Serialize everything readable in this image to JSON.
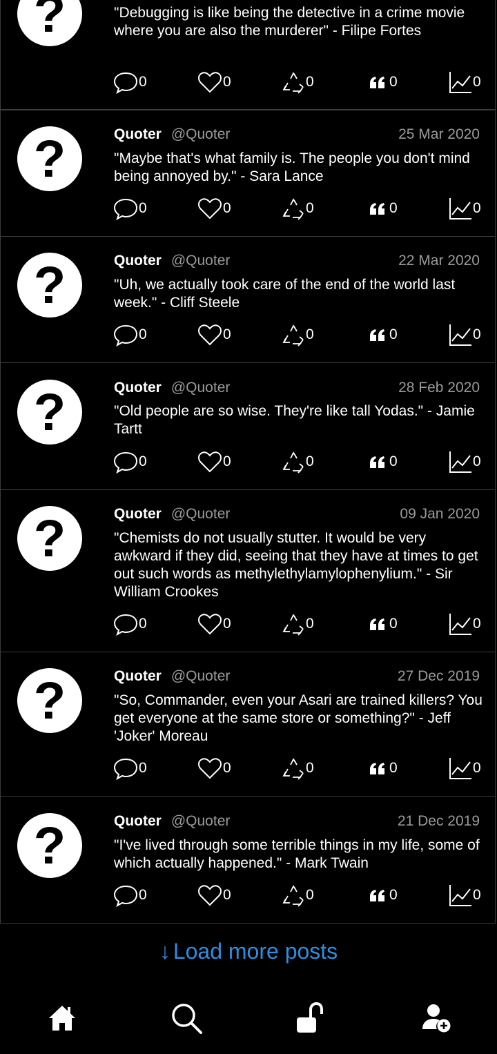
{
  "posts": [
    {
      "author": "",
      "handle": "",
      "date": "",
      "text": "\"Debugging is like being the detective in a crime movie where you are also the murderer\" - Filipe Fortes",
      "counts": {
        "comments": "0",
        "likes": "0",
        "reposts": "0",
        "quotes": "0",
        "stats": "0"
      }
    },
    {
      "author": "Quoter",
      "handle": "@Quoter",
      "date": "25 Mar 2020",
      "text": "\"Maybe that's what family is. The people you don't mind being annoyed by.\" - Sara Lance",
      "counts": {
        "comments": "0",
        "likes": "0",
        "reposts": "0",
        "quotes": "0",
        "stats": "0"
      }
    },
    {
      "author": "Quoter",
      "handle": "@Quoter",
      "date": "22 Mar 2020",
      "text": "\"Uh, we actually took care of the end of the world last week.\" - Cliff Steele",
      "counts": {
        "comments": "0",
        "likes": "0",
        "reposts": "0",
        "quotes": "0",
        "stats": "0"
      }
    },
    {
      "author": "Quoter",
      "handle": "@Quoter",
      "date": "28 Feb 2020",
      "text": "\"Old people are so wise. They're like tall Yodas.\" - Jamie Tartt",
      "counts": {
        "comments": "0",
        "likes": "0",
        "reposts": "0",
        "quotes": "0",
        "stats": "0"
      }
    },
    {
      "author": "Quoter",
      "handle": "@Quoter",
      "date": "09 Jan 2020",
      "text": "\"Chemists do not usually stutter. It would be very awkward if they did, seeing that they have at times to get out such words as methylethylamylophenylium.\" - Sir William Crookes",
      "counts": {
        "comments": "0",
        "likes": "0",
        "reposts": "0",
        "quotes": "0",
        "stats": "0"
      }
    },
    {
      "author": "Quoter",
      "handle": "@Quoter",
      "date": "27 Dec 2019",
      "text": "\"So, Commander, even your Asari are trained killers? You get everyone at the same store or something?\" - Jeff 'Joker' Moreau",
      "counts": {
        "comments": "0",
        "likes": "0",
        "reposts": "0",
        "quotes": "0",
        "stats": "0"
      }
    },
    {
      "author": "Quoter",
      "handle": "@Quoter",
      "date": "21 Dec 2019",
      "text": "\"I've lived through some terrible things in my life, some of which actually happened.\" - Mark Twain",
      "counts": {
        "comments": "0",
        "likes": "0",
        "reposts": "0",
        "quotes": "0",
        "stats": "0"
      }
    }
  ],
  "avatar_glyph": "?",
  "load_more": {
    "arrow": "↓",
    "label": "Load more posts"
  },
  "colors": {
    "accent": "#2e8ee0",
    "background": "#000000",
    "muted": "#9a9a9a",
    "divider": "#3c3c3c"
  },
  "nav": {
    "items": [
      {
        "icon": "home-icon"
      },
      {
        "icon": "search-icon"
      },
      {
        "icon": "unlock-icon"
      },
      {
        "icon": "add-user-icon"
      }
    ]
  }
}
